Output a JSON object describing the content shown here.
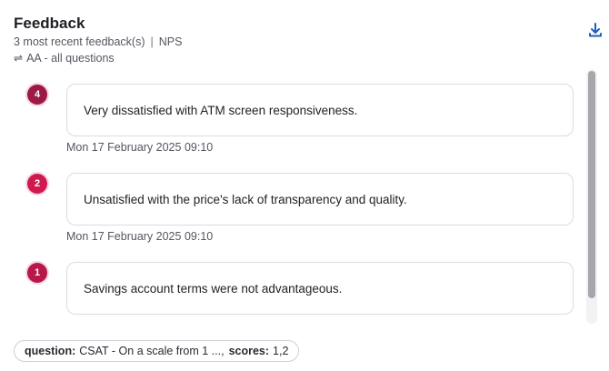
{
  "header": {
    "title": "Feedback",
    "count_text": "3 most recent feedback(s)",
    "separator": "|",
    "metric": "NPS",
    "filter_icon": "swap-icon",
    "filter_text": "AA - all questions",
    "download_icon": "download-icon"
  },
  "colors": {
    "accent": "#1e5fb8",
    "badge_dark": "#9c1a45",
    "badge_bright": "#d01a4f",
    "badge_mid": "#b8174a"
  },
  "feedback": [
    {
      "score": "4",
      "text": "Very dissatisfied with ATM screen responsiveness.",
      "date": "Mon 17 February 2025 09:10",
      "badge_color": "#9c1a45"
    },
    {
      "score": "2",
      "text": "Unsatisfied with the price's lack of transparency and quality.",
      "date": "Mon 17 February 2025 09:10",
      "badge_color": "#d01a4f"
    },
    {
      "score": "1",
      "text": "Savings account terms were not advantageous.",
      "date": "",
      "badge_color": "#b8174a"
    }
  ],
  "filter_chip": {
    "question_label": "question:",
    "question_value": "CSAT - On a scale from 1 ...,",
    "scores_label": "scores:",
    "scores_value": "1,2"
  }
}
